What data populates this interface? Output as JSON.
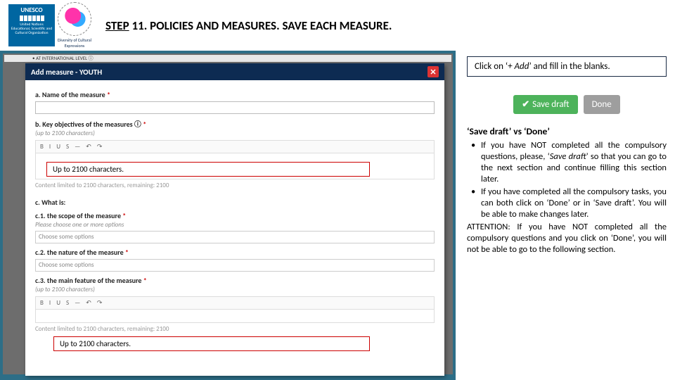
{
  "header": {
    "unesco_name": "UNESCO",
    "unesco_sub": "United Nations Educational, Scientific and Cultural Organization",
    "dce_sub": "Diversity of Cultural Expressions",
    "title_step": "STEP",
    "title_rest": " 11. POLICIES AND MEASURES. SAVE EACH MEASURE."
  },
  "screenshot": {
    "browser_strip": "• AT INTERNATIONAL LEVEL ⓘ",
    "modal_title": "Add measure - YOUTH",
    "close_x": "✕",
    "a_label": "a. Name of the measure",
    "b_label": "b. Key objectives of the measures ⓘ",
    "b_sub": "(up to 2100 characters)",
    "toolbar_btns": [
      "B",
      "I",
      "U",
      "S",
      "•",
      "—",
      "↶",
      "↷",
      "≡"
    ],
    "limit_text": "Content limited to 2100 characters, remaining: 2100",
    "c_label": "c. What is:",
    "c1_label": "c.1. the scope of the measure",
    "c1_hint": "Please choose one or more options",
    "c1_placeholder": "Choose some options",
    "c2_label": "c.2. the nature of the measure",
    "c2_placeholder": "Choose some options",
    "c3_label": "c.3. the main feature of the measure",
    "c3_sub": "(up to 2100 characters)",
    "req": " *"
  },
  "callouts": {
    "first": "Up to 2100 characters.",
    "second": "Up to 2100 characters."
  },
  "right": {
    "tip_pre": "Click on ‘",
    "tip_em": "+ Add",
    "tip_post": "’ and fill in the blanks.",
    "save_label": "Save draft",
    "done_label": "Done",
    "check": "✔",
    "explain_title": "‘Save draft’ vs ‘Done’",
    "bullet1_a": "If you have NOT completed all the compulsory questions, please, ‘",
    "bullet1_em": "Save draft",
    "bullet1_b": "’ so that you can go to the next section and continue filling this section later.",
    "bullet2": "If you have completed all the compulsory tasks, you can both click on ‘Done’ or in ‘Save draft’. You will be able to make changes later.",
    "attention": "ATTENTION: If you have NOT completed all the compulsory questions and you click on ‘Done’, you will not be able to go to the following section."
  }
}
